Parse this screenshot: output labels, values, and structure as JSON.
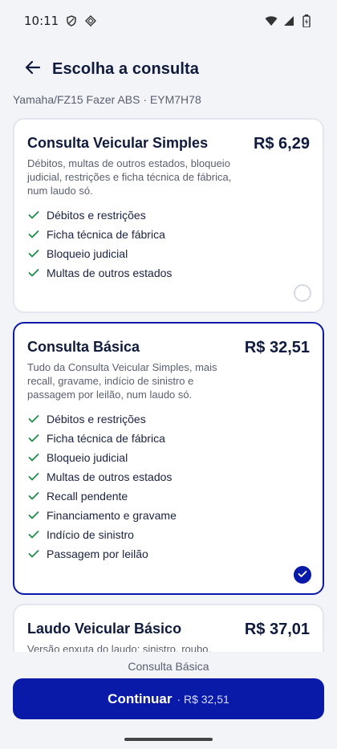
{
  "status_bar": {
    "time": "10:11",
    "left_icons": [
      "shield-icon",
      "diamond-icon"
    ],
    "right_icons": [
      "wifi-icon",
      "signal-icon",
      "battery-icon"
    ]
  },
  "header": {
    "title": "Escolha a consulta",
    "back_icon": "arrow-left-icon"
  },
  "vehicle": "Yamaha/FZ15 Fazer ABS · EYM7H78",
  "options": [
    {
      "name": "Consulta Veicular Simples",
      "price": "R$ 6,29",
      "description": "Débitos, multas de outros estados, bloqueio judicial, restrições e ficha técnica de fábrica, num laudo só.",
      "features": [
        "Débitos e restrições",
        "Ficha técnica de fábrica",
        "Bloqueio judicial",
        "Multas de outros estados"
      ],
      "selected": false
    },
    {
      "name": "Consulta Básica",
      "price": "R$ 32,51",
      "description": "Tudo da Consulta Veicular Simples, mais recall, gravame, indício de sinistro e passagem por leilão, num laudo só.",
      "features": [
        "Débitos e restrições",
        "Ficha técnica de fábrica",
        "Bloqueio judicial",
        "Multas de outros estados",
        "Recall pendente",
        "Financiamento e gravame",
        "Indício de sinistro",
        "Passagem por leilão"
      ],
      "selected": true
    },
    {
      "name": "Laudo Veicular Básico",
      "price": "R$ 37,01",
      "description": "Versão enxuta do laudo: sinistro, roubo,",
      "features": [],
      "selected": false
    }
  ],
  "footer": {
    "summary": "Consulta Básica",
    "continue_label": "Continuar",
    "continue_price": "· R$ 32,51"
  },
  "colors": {
    "primary": "#0a1aa8",
    "check": "#1f8a4c",
    "text": "#0f1a3d",
    "muted": "#5a6070"
  }
}
